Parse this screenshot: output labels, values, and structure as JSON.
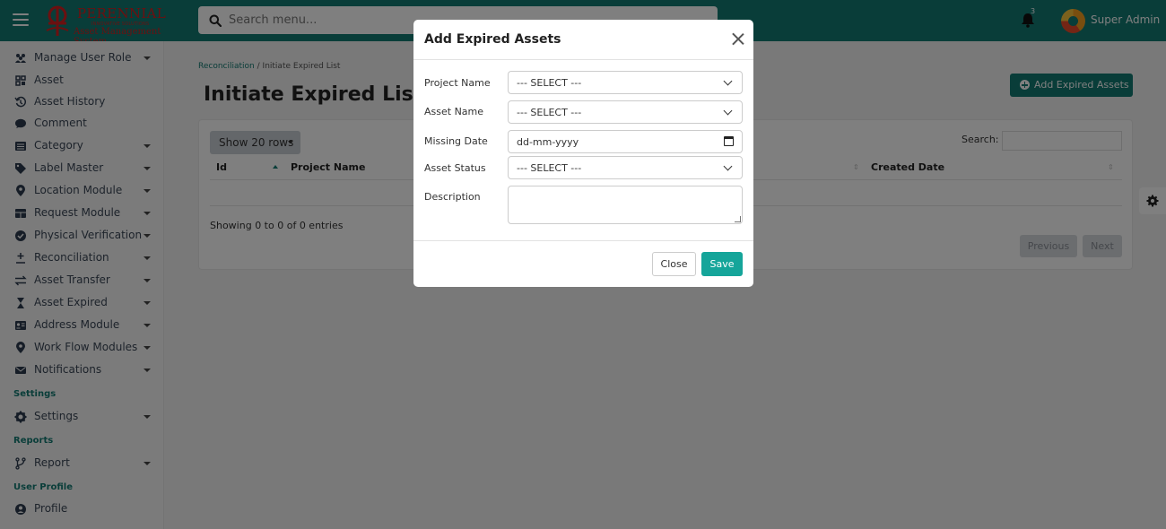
{
  "header": {
    "logo_title": "PERENNIAL",
    "logo_subtitle": "INNOVATIVE SOLUTIONS",
    "logo_tagline": "Asset Management System",
    "search_placeholder": "Search menu...",
    "notification_count": "3",
    "user_name": "Super Admin"
  },
  "sidebar": {
    "items": [
      {
        "label": "Manage User Role",
        "icon": "users-icon"
      },
      {
        "label": "Asset",
        "icon": "grid-icon"
      },
      {
        "label": "Asset History",
        "icon": "history-icon"
      },
      {
        "label": "Comment",
        "icon": "comment-icon"
      },
      {
        "label": "Category",
        "icon": "list-icon"
      },
      {
        "label": "Label Master",
        "icon": "tag-icon"
      },
      {
        "label": "Location Module",
        "icon": "location-icon"
      },
      {
        "label": "Request Module",
        "icon": "table-icon"
      },
      {
        "label": "Physical Verification",
        "icon": "check-circle-icon"
      },
      {
        "label": "Reconciliation",
        "icon": "plus-minus-icon"
      },
      {
        "label": "Asset Transfer",
        "icon": "transfer-icon"
      },
      {
        "label": "Asset Expired",
        "icon": "hourglass-icon"
      },
      {
        "label": "Address Module",
        "icon": "id-card-icon"
      },
      {
        "label": "Work Flow Modules",
        "icon": "location-icon"
      },
      {
        "label": "Notifications",
        "icon": "envelope-icon"
      }
    ],
    "section_settings": "Settings",
    "settings_item": "Settings",
    "section_reports": "Reports",
    "report_item": "Report",
    "section_profile": "User Profile",
    "profile_item": "Profile"
  },
  "breadcrumb": {
    "parent": "Reconciliation",
    "separator": "/",
    "current": "Initiate Expired List"
  },
  "page_title": "Initiate Expired List",
  "add_button": "Add Expired Assets",
  "table": {
    "show_rows": "Show 20 rows",
    "search_label": "Search:",
    "columns": [
      "Id",
      "Project Name",
      "Created Date"
    ],
    "info": "Showing 0 to 0 of 0 entries",
    "previous": "Previous",
    "next": "Next"
  },
  "modal": {
    "title": "Add Expired Assets",
    "fields": {
      "project_name_label": "Project Name",
      "project_name_value": "--- SELECT ---",
      "asset_name_label": "Asset Name",
      "asset_name_value": "--- SELECT ---",
      "missing_date_label": "Missing Date",
      "missing_date_value": "dd-mm-yyyy",
      "asset_status_label": "Asset Status",
      "asset_status_value": "--- SELECT ---",
      "description_label": "Description",
      "description_value": ""
    },
    "close_label": "Close",
    "save_label": "Save"
  },
  "colors": {
    "primary": "#137a72",
    "save": "#15a59a",
    "logo_red": "#d62020"
  }
}
